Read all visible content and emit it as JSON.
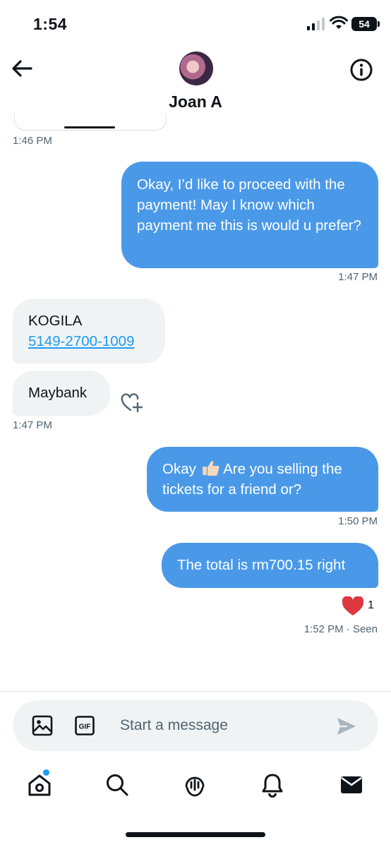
{
  "status_bar": {
    "time": "1:54",
    "battery": "54"
  },
  "header": {
    "contact_name": "Joan A"
  },
  "messages": [
    {
      "side": "received",
      "timestamp": "1:46 PM"
    },
    {
      "side": "sent",
      "text": "Okay, I’d like to proceed with the payment! May I know which payment me this is would u prefer?",
      "timestamp": "1:47 PM"
    },
    {
      "side": "received",
      "line1": "KOGILA",
      "link": "5149-2700-1009"
    },
    {
      "side": "received",
      "text": "Maybank",
      "timestamp": "1:47 PM"
    },
    {
      "side": "sent",
      "text_before": "Okay ",
      "emoji": "thumbs-up",
      "text_after": " Are you selling the tickets for a friend or?",
      "timestamp": "1:50 PM"
    },
    {
      "side": "sent",
      "text": "The total is rm700.15 right",
      "reaction_count": "1",
      "timestamp": "1:52 PM",
      "seen": "· Seen"
    }
  ],
  "composer": {
    "placeholder": "Start a message"
  },
  "colors": {
    "accent": "#1d9bf0",
    "sent_bubble": "#4a99e9",
    "received_bubble": "#eff3f4",
    "heart": "#e0245e"
  },
  "nav": {
    "items": [
      "home-icon",
      "search-icon",
      "spaces-icon",
      "notifications-icon",
      "messages-icon"
    ]
  }
}
